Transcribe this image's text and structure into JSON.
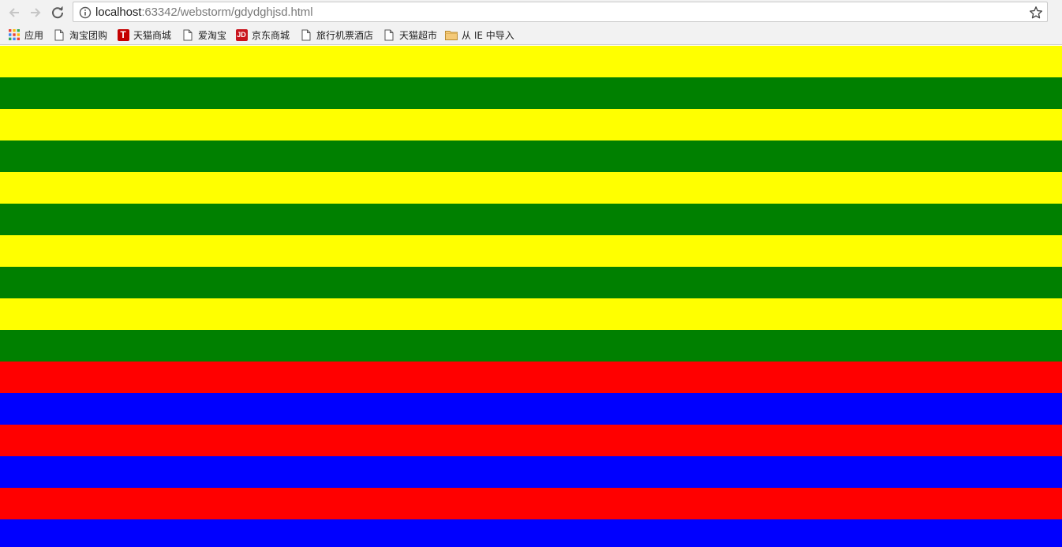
{
  "browser": {
    "url_host": "localhost",
    "url_path": ":63342/webstorm/gdydghjsd.html"
  },
  "bookmarks": [
    {
      "label": "应用",
      "icon": "apps-grid-icon"
    },
    {
      "label": "淘宝团购",
      "icon": "page-icon"
    },
    {
      "label": "天猫商城",
      "icon": "tmall-logo-icon",
      "badge": "T",
      "color": "#c40000"
    },
    {
      "label": "爱淘宝",
      "icon": "page-icon"
    },
    {
      "label": "京东商城",
      "icon": "jd-logo-icon",
      "badge": "JD",
      "color": "#c9151e"
    },
    {
      "label": "旅行机票酒店",
      "icon": "page-icon"
    },
    {
      "label": "天猫超市",
      "icon": "page-icon"
    },
    {
      "label": "从 IE 中导入",
      "icon": "folder-icon",
      "color": "#f4c978"
    }
  ],
  "stripes": [
    {
      "color": "#ffff00"
    },
    {
      "color": "#008000"
    },
    {
      "color": "#ffff00"
    },
    {
      "color": "#008000"
    },
    {
      "color": "#ffff00"
    },
    {
      "color": "#008000"
    },
    {
      "color": "#ffff00"
    },
    {
      "color": "#008000"
    },
    {
      "color": "#ffff00"
    },
    {
      "color": "#008000"
    },
    {
      "color": "#ff0000"
    },
    {
      "color": "#0000ff"
    },
    {
      "color": "#ff0000"
    },
    {
      "color": "#0000ff"
    },
    {
      "color": "#ff0000"
    },
    {
      "color": "#0000ff"
    }
  ]
}
